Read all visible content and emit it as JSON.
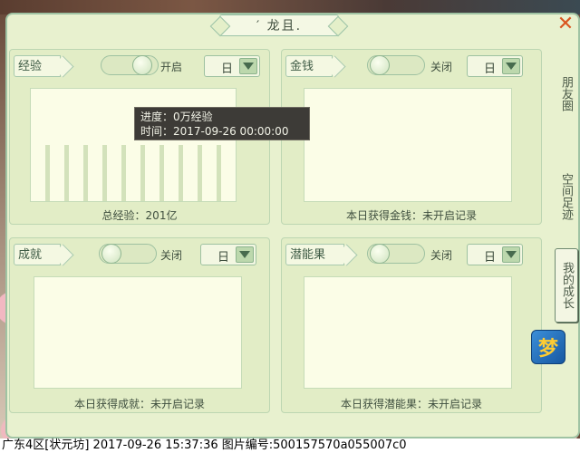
{
  "window": {
    "title": "′ 龙且.",
    "close_glyph": "✕"
  },
  "panels": [
    {
      "id": "exp",
      "label": "经验",
      "toggle_state": "on",
      "toggle_text": "开启",
      "period": "日",
      "footer": "总经验：201亿"
    },
    {
      "id": "money",
      "label": "金钱",
      "toggle_state": "off",
      "toggle_text": "关闭",
      "period": "日",
      "footer": "本日获得金钱：未开启记录"
    },
    {
      "id": "achievement",
      "label": "成就",
      "toggle_state": "off",
      "toggle_text": "关闭",
      "period": "日",
      "footer": "本日获得成就：未开启记录"
    },
    {
      "id": "potential",
      "label": "潜能果",
      "toggle_state": "off",
      "toggle_text": "关闭",
      "period": "日",
      "footer": "本日获得潜能果：未开启记录"
    }
  ],
  "tooltip": {
    "line1": "进度：0万经验",
    "line2": "时间：2017-09-26 00:00:00"
  },
  "side_tabs": [
    {
      "label": "朋友圈",
      "active": false
    },
    {
      "label": "空间足迹",
      "active": false
    },
    {
      "label": "我的成长",
      "active": true
    }
  ],
  "app_icon": {
    "glyph": "梦"
  },
  "status_bar": {
    "text": "广东4区[状元坊] 2017-09-26 15:37:36 图片编号:500157570a055007c0"
  },
  "colors": {
    "panel_bg": "#e2edc6",
    "accent_green": "#9ec1a1",
    "close_orange": "#d9551f",
    "tooltip_bg": "#3d3b37"
  }
}
